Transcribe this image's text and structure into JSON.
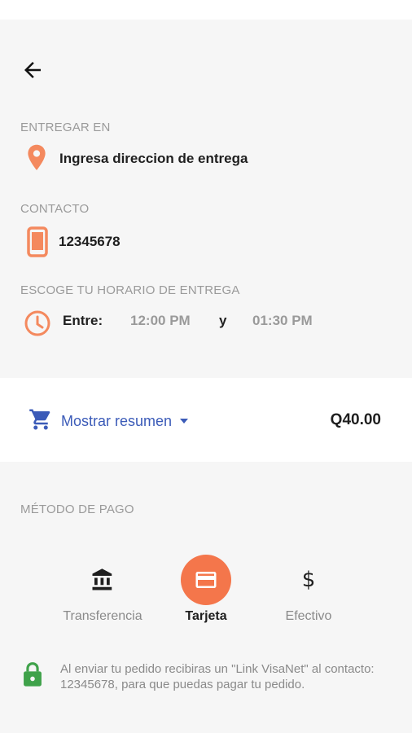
{
  "delivery": {
    "label": "ENTREGAR EN",
    "address_value": "Ingresa direccion de entrega"
  },
  "contact": {
    "label": "CONTACTO",
    "phone": "12345678"
  },
  "schedule": {
    "label": "ESCOGE TU HORARIO DE ENTREGA",
    "between_label": "Entre:",
    "from_time": "12:00 PM",
    "connector": "y",
    "to_time": "01:30 PM"
  },
  "summary": {
    "toggle_label": "Mostrar resumen",
    "total": "Q40.00"
  },
  "payment": {
    "label": "MÉTODO DE PAGO",
    "options": [
      {
        "label": "Transferencia",
        "icon": "bank-icon",
        "selected": false
      },
      {
        "label": "Tarjeta",
        "icon": "credit-card-icon",
        "selected": true
      },
      {
        "label": "Efectivo",
        "icon": "dollar-icon",
        "selected": false
      }
    ],
    "note": "Al enviar tu pedido recibiras un \"Link VisaNet\" al contacto: 12345678, para que puedas pagar tu pedido."
  },
  "colors": {
    "accent": "#f4764b",
    "link": "#3b5bb8",
    "lock": "#3fa24a"
  }
}
